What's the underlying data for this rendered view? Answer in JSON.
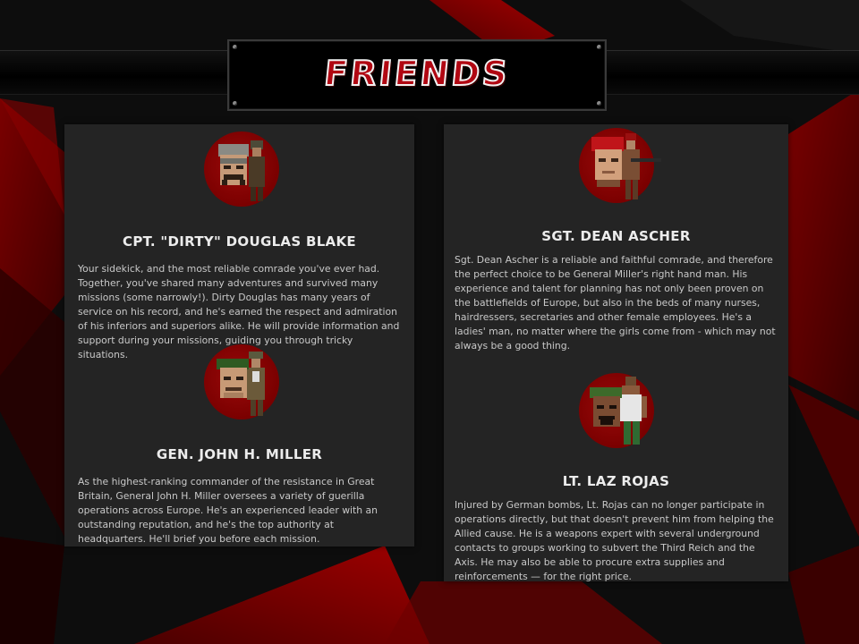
{
  "header": {
    "title": "FRIENDS"
  },
  "friends": [
    {
      "name": "CPT. \"DIRTY\" DOUGLAS BLAKE",
      "description": "Your sidekick, and the most reliable comrade you've ever had. Together, you've shared many adventures and survived many missions (some narrowly!). Dirty Douglas has many years of service on his record, and he's earned the respect and admiration of his inferiors and superiors alike. He will provide information and support during your missions, guiding you through tricky situations."
    },
    {
      "name": "GEN. JOHN H. MILLER",
      "description": "As the highest-ranking commander of the resistance in Great Britain, General John H. Miller oversees a variety of guerilla operations across Europe. He's an experienced leader with an outstanding reputation, and he's the top authority at headquarters. He'll brief you before each mission."
    },
    {
      "name": "SGT. DEAN ASCHER",
      "description": "Sgt. Dean Ascher is a reliable and faithful comrade, and therefore the perfect choice to be General Miller's right hand man. His experience and talent for planning has not only been proven on the battlefields of Europe, but also in the beds of many nurses, hairdressers, secretaries and other female employees. He's a ladies' man, no matter where the girls come from - which may not always be a good thing."
    },
    {
      "name": "LT. LAZ ROJAS",
      "description": "Injured by German bombs, Lt. Rojas can no longer participate in operations directly, but that doesn't prevent him from helping the Allied cause. He is a weapons expert with several underground contacts to groups working to subvert the Third Reich and the Axis. He may also be able to procure extra supplies and reinforcements — for the right price."
    }
  ],
  "colors": {
    "accent_red": "#8a0000",
    "card_bg": "#242424",
    "page_bg": "#0c0c0c",
    "title_fill": "#b10712"
  },
  "icons": [
    "douglas-blake-portrait-icon",
    "john-miller-portrait-icon",
    "dean-ascher-portrait-icon",
    "laz-rojas-portrait-icon"
  ]
}
